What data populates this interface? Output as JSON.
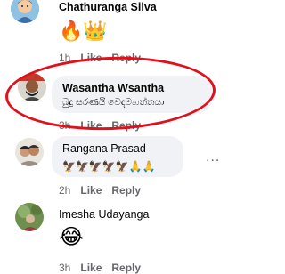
{
  "colors": {
    "bubble": "#f0f2f5",
    "meta_text": "#65676b",
    "annotation_ellipse": "#e0111b"
  },
  "comments": [
    {
      "author": "Chathuranga Silva",
      "text": "🔥👑",
      "time": "1h",
      "like": "Like",
      "reply": "Reply",
      "avatar_icon": "avatar-cartoon-icon"
    },
    {
      "author": "Wasantha Wsantha",
      "text": "බුදු සරණයි වෙදමහත්තයා",
      "time": "3h",
      "like": "Like",
      "reply": "Reply",
      "avatar_icon": "avatar-photo-icon",
      "highlighted": true
    },
    {
      "author": "Rangana Prasad",
      "text": "🦅🦅🦅🦅🦅🙏🙏",
      "time": "2h",
      "like": "Like",
      "reply": "Reply",
      "more": "...",
      "avatar_icon": "avatar-photo-icon"
    },
    {
      "author": "Imesha Udayanga",
      "text": "😂",
      "time": "3h",
      "like": "Like",
      "reply": "Reply",
      "avatar_icon": "avatar-photo-icon"
    }
  ]
}
